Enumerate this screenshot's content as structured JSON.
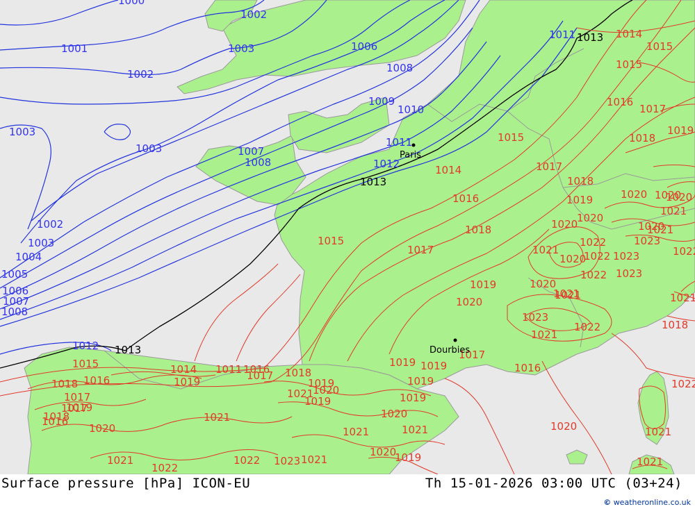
{
  "colors": {
    "sea": "#e9e9e9",
    "land": "#aaf08c",
    "low": "#2233dd",
    "high": "#e23a2a",
    "ref": "#000000"
  },
  "title_left": "Surface pressure [hPa] ICON-EU",
  "title_right": "Th 15-01-2026 03:00 UTC (03+24)",
  "credit": {
    "symbol": "©",
    "text": "weatheronline.co.uk"
  },
  "cities": [
    {
      "name": "Paris"
    },
    {
      "name": "Dourbies"
    }
  ],
  "labels_blue": [
    "1000",
    "1002",
    "1001",
    "1002",
    "1003",
    "1006",
    "1008",
    "1011",
    "1003",
    "1009",
    "1010",
    "1003",
    "1007",
    "1008",
    "1011",
    "1012",
    "1002",
    "1003",
    "1004",
    "1005",
    "1006",
    "1007",
    "1008",
    "1012"
  ],
  "labels_black": [
    "1013",
    "1013",
    "1013"
  ],
  "labels_red": [
    "1014",
    "1015",
    "1016",
    "1017",
    "1015",
    "1014",
    "1016",
    "1017",
    "1018",
    "1018",
    "1019",
    "1015",
    "1017",
    "1018",
    "1019",
    "1020",
    "1020",
    "1020",
    "1020",
    "1021",
    "1021",
    "1022",
    "1023",
    "1023",
    "1020",
    "1022",
    "1021",
    "1022",
    "1023",
    "1022",
    "1021",
    "1020",
    "1021",
    "1020",
    "1019",
    "1018",
    "1017",
    "1016",
    "1015",
    "1014",
    "1011",
    "1016",
    "1017",
    "1018",
    "1019",
    "1019",
    "1019",
    "1019",
    "1021",
    "1020",
    "1019",
    "1020",
    "1021",
    "1021",
    "1020",
    "1019",
    "1021",
    "1022",
    "1023",
    "1022",
    "1021",
    "1020",
    "1021",
    "1019",
    "1018",
    "1017",
    "1016",
    "1020",
    "1021",
    "1022",
    "1021",
    "1023",
    "1020",
    "1021",
    "1022",
    "1021",
    "1020",
    "1019",
    "1019",
    "1018",
    "1017",
    "1016",
    "1015"
  ]
}
